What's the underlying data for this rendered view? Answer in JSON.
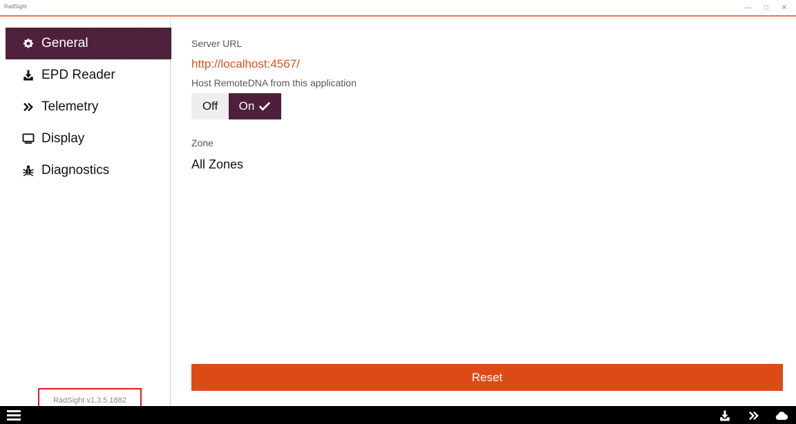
{
  "window": {
    "title": "RadSight",
    "controls": {
      "minimize": "—",
      "restore": "□",
      "close": "✕"
    }
  },
  "sidebar": {
    "items": [
      {
        "label": "General",
        "icon": "gear-icon",
        "active": true
      },
      {
        "label": "EPD Reader",
        "icon": "download-icon",
        "active": false
      },
      {
        "label": "Telemetry",
        "icon": "double-chevron-right-icon",
        "active": false
      },
      {
        "label": "Display",
        "icon": "monitor-icon",
        "active": false
      },
      {
        "label": "Diagnostics",
        "icon": "bug-icon",
        "active": false
      }
    ],
    "version": "RadSight v1.3.5.1882"
  },
  "main": {
    "server_url_label": "Server URL",
    "server_url_value": "http://localhost:4567/",
    "host_label": "Host RemoteDNA from this application",
    "toggle": {
      "off_label": "Off",
      "on_label": "On",
      "selected": "On"
    },
    "zone_label": "Zone",
    "zone_value": "All Zones",
    "reset_label": "Reset"
  },
  "bottombar": {
    "icons": [
      "menu-icon",
      "download-icon",
      "double-chevron-right-icon",
      "cloud-icon"
    ]
  },
  "colors": {
    "accent": "#4e1f3b",
    "brand_orange": "#dc4b16",
    "url_orange": "#d9531e",
    "highlight_red": "#e11a1a"
  }
}
